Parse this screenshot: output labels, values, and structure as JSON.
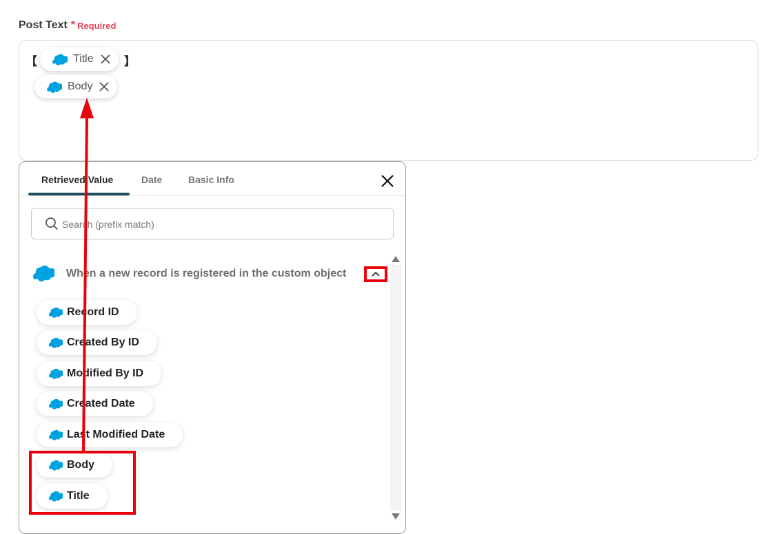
{
  "field": {
    "label": "Post Text",
    "required_star": "*",
    "required_text": "Required"
  },
  "editor": {
    "open_bracket": "【",
    "close_bracket": "】",
    "chips": [
      {
        "label": "Title",
        "icon": "salesforce-cloud-icon"
      },
      {
        "label": "Body",
        "icon": "salesforce-cloud-icon"
      }
    ]
  },
  "panel": {
    "tabs": [
      {
        "label": "Retrieved Value",
        "active": true
      },
      {
        "label": "Date",
        "active": false
      },
      {
        "label": "Basic Info",
        "active": false
      }
    ],
    "search_placeholder": "Search (prefix match)",
    "section_title": "When a new record is registered in the custom object",
    "items": [
      {
        "label": "Record ID"
      },
      {
        "label": "Created By ID"
      },
      {
        "label": "Modified By ID"
      },
      {
        "label": "Created Date"
      },
      {
        "label": "Last Modified Date"
      },
      {
        "label": "Body"
      },
      {
        "label": "Title"
      }
    ]
  },
  "colors": {
    "required": "#e0435a",
    "salesforce_blue": "#00a1e0",
    "tab_underline": "#1f4f63",
    "annotation_red": "#e8000b"
  }
}
